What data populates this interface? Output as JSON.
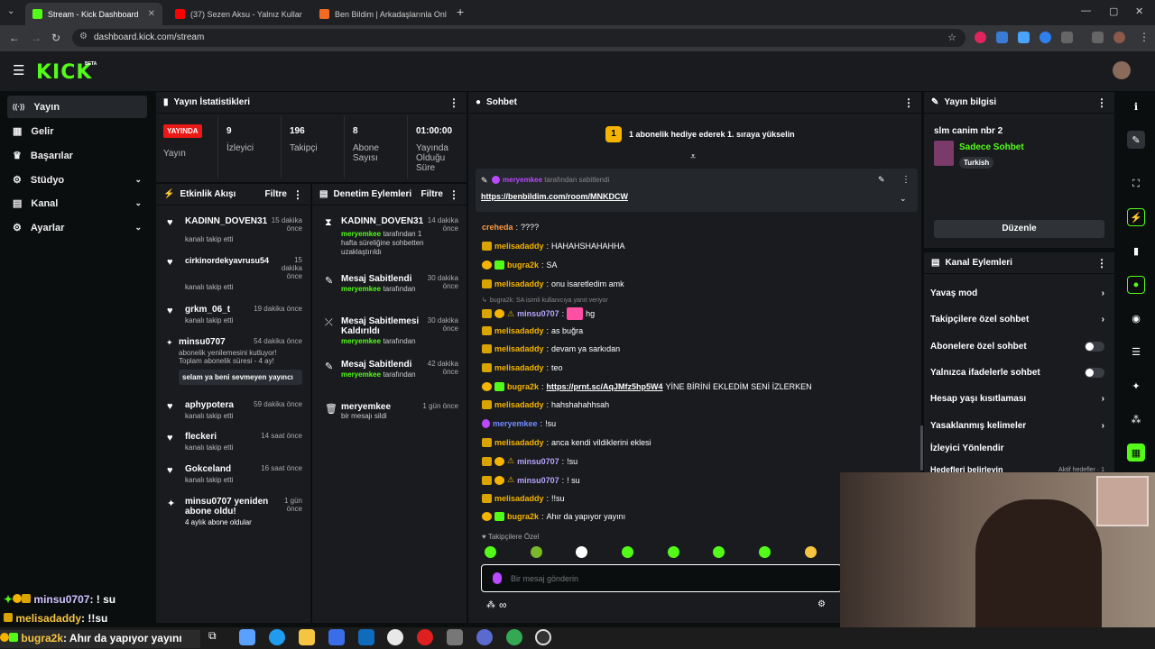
{
  "browser": {
    "tabs": [
      {
        "title": "Stream - Kick Dashboard",
        "active": true,
        "color": "#53fc18"
      },
      {
        "title": "(37) Sezen Aksu - Yalnız Kullar",
        "active": false,
        "color": "#ff0000"
      },
      {
        "title": "Ben Bildim | Arkadaşlarınla Onl",
        "active": false,
        "color": "#f26b21"
      }
    ],
    "new_tab": "+",
    "url": "dashboard.kick.com/stream"
  },
  "header": {
    "logo": "KICK",
    "beta": "BETA"
  },
  "nav": {
    "items": [
      {
        "label": "Yayın",
        "active": true,
        "icon": "broadcast-icon",
        "glyph": "((·))"
      },
      {
        "label": "Gelir",
        "icon": "revenue-icon",
        "glyph": "▦"
      },
      {
        "label": "Başarılar",
        "icon": "trophy-icon",
        "glyph": "♛"
      },
      {
        "label": "Stüdyo",
        "icon": "studio-icon",
        "glyph": "⚙",
        "chevron": "⌄"
      },
      {
        "label": "Kanal",
        "icon": "channel-icon",
        "glyph": "▤",
        "chevron": "⌄"
      },
      {
        "label": "Ayarlar",
        "icon": "settings-icon",
        "glyph": "⚙",
        "chevron": "⌄"
      }
    ]
  },
  "stats": {
    "title": "Yayın İstatistikleri",
    "live_badge": "YAYINDA",
    "live_label": "Yayın",
    "viewers": "9",
    "viewers_label": "İzleyici",
    "followers": "196",
    "followers_label": "Takipçi",
    "subs": "8",
    "subs_label": "Abone Sayısı",
    "duration": "01:00:00",
    "duration_label": "Yayında Olduğu Süre"
  },
  "activity": {
    "title": "Etkinlik Akışı",
    "filter": "Filtre",
    "events": [
      {
        "name": "KADINN_DOVEN31",
        "sub": "kanalı takip etti",
        "time": "15 dakika önce"
      },
      {
        "name": "cirkinordekyavrusu54",
        "sub": "kanalı takip etti",
        "time": "15 dakika önce"
      },
      {
        "name": "grkm_06_t",
        "sub": "kanalı takip etti",
        "time": "19 dakika önce"
      },
      {
        "name": "minsu0707",
        "sub": "abonelik yenilemesini kutluyor! Toplam abonelik süresi - 4 ay!",
        "time": "54 dakika önce",
        "msg": "selam ya beni sevmeyen yayıncı"
      },
      {
        "name": "aphypotera",
        "sub": "kanalı takip etti",
        "time": "59 dakika önce"
      },
      {
        "name": "fleckeri",
        "sub": "kanalı takip etti",
        "time": "14 saat önce"
      },
      {
        "name": "Gokceland",
        "sub": "kanalı takip etti",
        "time": "16 saat önce"
      },
      {
        "name": "minsu0707 yeniden abone oldu!",
        "sub": "4 aylık abone oldular",
        "time": "1 gün önce"
      }
    ]
  },
  "moderation": {
    "title": "Denetim Eylemleri",
    "filter": "Filtre",
    "actions": [
      {
        "name": "KADINN_DOVEN31",
        "by": "meryemkee",
        "sub": "tarafından 1 hafta süreliğine sohbetten uzaklaştırıldı",
        "time": "14 dakika önce"
      },
      {
        "name": "Mesaj Sabitlendi",
        "by": "meryemkee",
        "sub": "tarafından",
        "time": "30 dakika önce"
      },
      {
        "name": "Mesaj Sabitlemesi Kaldırıldı",
        "by": "meryemkee",
        "sub": "tarafından",
        "time": "30 dakika önce"
      },
      {
        "name": "Mesaj Sabitlendi",
        "by": "meryemkee",
        "sub": "tarafından",
        "time": "42 dakika önce"
      },
      {
        "name": "meryemkee",
        "by": "",
        "sub": "bir mesajı sildi",
        "time": "1 gün önce"
      }
    ]
  },
  "chat": {
    "title": "Sohbet",
    "promo": "1 abonelik hediye ederek 1. sıraya yükselin",
    "promo_num": "1",
    "pinned_by": "meryemkee",
    "pinned_by_suffix": "tarafından sabitlendi",
    "pinned_link": "https://benbildim.com/room/MNKDCW",
    "reply_hint": "bugra2k: SA isimli kullanıcıya yanıt veriyor",
    "messages": [
      {
        "user": "creheda",
        "text": "????",
        "color": "#ff9a3c"
      },
      {
        "user": "melisadaddy",
        "text": "HAHAHSHAHAHHA",
        "color": "#f5b400"
      },
      {
        "user": "bugra2k",
        "text": "SA",
        "color": "#f5b400"
      },
      {
        "user": "melisadaddy",
        "text": "onu isaretledim amk",
        "color": "#f5b400"
      },
      {
        "user": "minsu0707",
        "text": "hg",
        "color": "#b9a6ff"
      },
      {
        "user": "melisadaddy",
        "text": "as buğra",
        "color": "#f5b400"
      },
      {
        "user": "melisadaddy",
        "text": "devam ya sarkıdan",
        "color": "#f5b400"
      },
      {
        "user": "melisadaddy",
        "text": "teo",
        "color": "#f5b400"
      },
      {
        "user": "bugra2k",
        "link": "https://prnt.sc/AqJMfz5hp5W4",
        "text": "YİNE BİRİNİ EKLEDİM SENİ İZLERKEN",
        "color": "#f5b400"
      },
      {
        "user": "melisadaddy",
        "text": "hahshahahhsah",
        "color": "#f5b400"
      },
      {
        "user": "meryemkee",
        "text": "!su",
        "color": "#b94aff"
      },
      {
        "user": "melisadaddy",
        "text": "anca kendi vildiklerini eklesi",
        "color": "#f5b400"
      },
      {
        "user": "minsu0707",
        "text": "!su",
        "color": "#b9a6ff"
      },
      {
        "user": "minsu0707",
        "text": "! su",
        "color": "#b9a6ff"
      },
      {
        "user": "melisadaddy",
        "text": "!!su",
        "color": "#f5b400"
      },
      {
        "user": "bugra2k",
        "text": "Ahır da yapıyor yayını",
        "color": "#f5b400"
      }
    ],
    "followers_only": "Takipçilere Özel",
    "input_placeholder": "Bir mesaj gönderin",
    "infinity": "∞"
  },
  "stream_info": {
    "title": "Yayın bilgisi",
    "stream_title": "slm canim nbr 2",
    "category": "Sadece Sohbet",
    "language": "Turkish",
    "edit_button": "Düzenle"
  },
  "channel_actions": {
    "title": "Kanal Eylemleri",
    "items": [
      {
        "label": "Yavaş mod",
        "type": "chevron"
      },
      {
        "label": "Takipçilere özel sohbet",
        "type": "chevron"
      },
      {
        "label": "Abonelere özel sohbet",
        "type": "toggle"
      },
      {
        "label": "Yalnızca ifadelerle sohbet",
        "type": "toggle"
      },
      {
        "label": "Hesap yaşı kısıtlaması",
        "type": "chevron"
      },
      {
        "label": "Yasaklanmış kelimeler",
        "type": "chevron"
      },
      {
        "label": "İzleyici Yönlendir",
        "type": "none"
      }
    ],
    "partial": "Hedefleri belirleyin",
    "partial_right": "Aktif hedefler · 1"
  },
  "overlay": {
    "line1_user": "minsu0707",
    "line1_text": ": ! su",
    "line2_user": "melisadaddy",
    "line2_text": ": !!su",
    "line3_user": "bugra2k",
    "line3_text": ": Ahır da yapıyor yayını"
  },
  "window_controls": {
    "minimize": "—",
    "maximize": "▢",
    "close": "✕"
  }
}
